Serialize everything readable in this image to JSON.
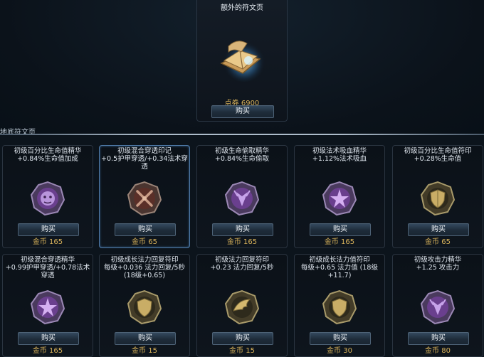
{
  "featured": {
    "title": "额外的符文页",
    "price": "点券 6900",
    "buy_label": "购买"
  },
  "section": {
    "label": "地底符文页"
  },
  "runes_row1": [
    {
      "name": "初级百分比生命值精华",
      "desc": "+0.84%生命值加成",
      "buy": "购买",
      "price": "金币 165",
      "icon": "purple-lion-rune-icon"
    },
    {
      "name": "初级混合穿透印记",
      "desc": "+0.5护甲穿透/+0.34法术穿透",
      "buy": "购买",
      "price": "金币 65",
      "icon": "red-crossed-swords-rune-icon"
    },
    {
      "name": "初级生命偷取精华",
      "desc": "+0.84%生命偷取",
      "buy": "购买",
      "price": "金币 165",
      "icon": "purple-dragon-rune-icon"
    },
    {
      "name": "初级法术吸血精华",
      "desc": "+1.12%法术吸血",
      "buy": "购买",
      "price": "金币 165",
      "icon": "purple-flower-rune-icon"
    },
    {
      "name": "初级百分比生命值符印",
      "desc": "+0.28%生命值",
      "buy": "购买",
      "price": "金币 65",
      "icon": "gold-shield-rune-icon"
    }
  ],
  "runes_row2": [
    {
      "name": "初级混合穿透精华",
      "desc": "+0.99护甲穿透/+0.78法术穿透",
      "buy": "购买",
      "price": "金币 165",
      "icon": "purple-flower-rune-icon"
    },
    {
      "name": "初级成长法力回复符印",
      "desc": "每级+0.036 法力回复/5秒(18级+0.65)",
      "buy": "购买",
      "price": "金币 15",
      "icon": "gold-shield-rune-icon"
    },
    {
      "name": "初级法力回复符印",
      "desc": "+0.23 法力回复/5秒",
      "buy": "购买",
      "price": "金币 15",
      "icon": "gold-wing-rune-icon"
    },
    {
      "name": "初级成长法力值符印",
      "desc": "每级+0.65 法力值 (18级+11.7)",
      "buy": "购买",
      "price": "金币 30",
      "icon": "gold-shield-rune-icon"
    },
    {
      "name": "初级攻击力精华",
      "desc": "+1.25 攻击力",
      "buy": "购买",
      "price": "金币 80",
      "icon": "purple-dragon-rune-icon"
    }
  ],
  "colors": {
    "price": "#d8b25a",
    "accent": "#4f7aa8",
    "background": "#0c141c"
  }
}
